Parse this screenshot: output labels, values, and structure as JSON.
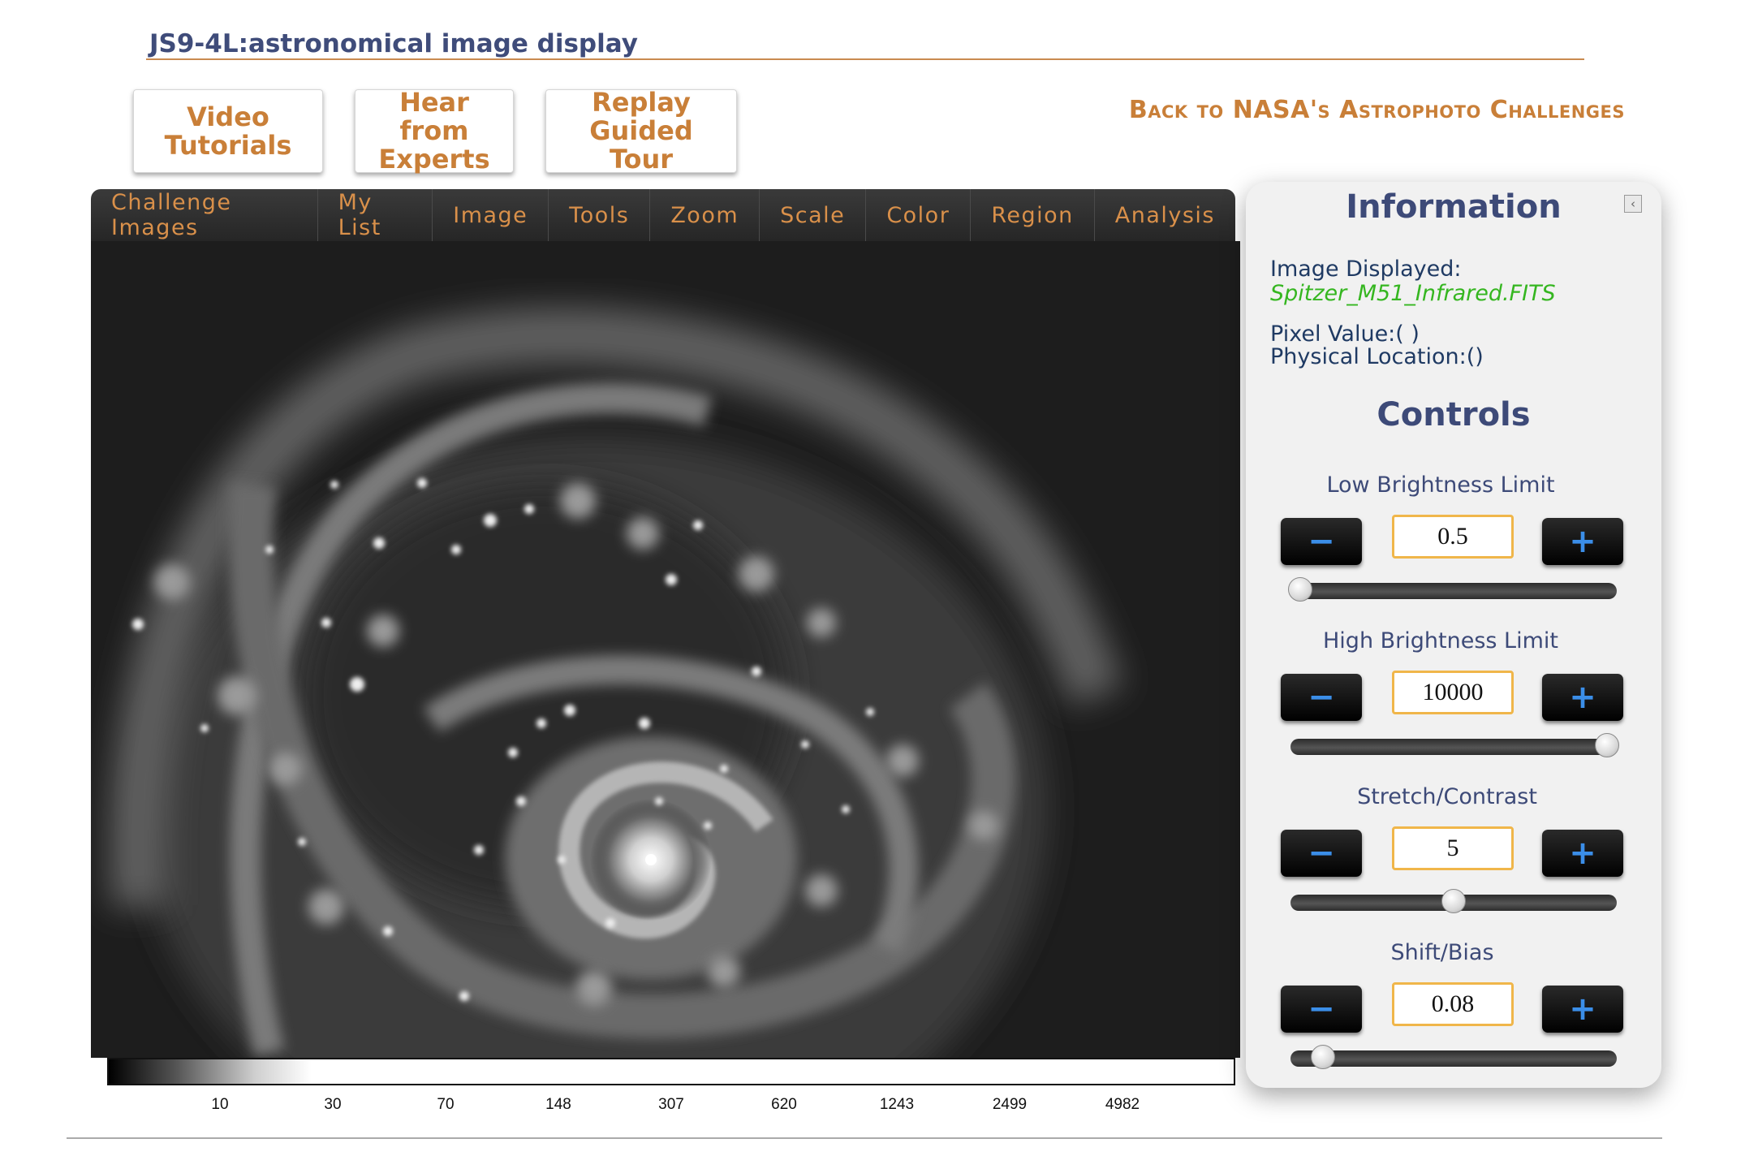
{
  "header": {
    "title": "JS9-4L:astronomical image display",
    "buttons": [
      {
        "label": "Video Tutorials"
      },
      {
        "label": "Hear from Experts"
      },
      {
        "label": "Replay Guided Tour"
      }
    ],
    "back_link": "Back to NASA's Astrophoto Challenges"
  },
  "menubar": {
    "items": [
      "Challenge Images",
      "My List",
      "Image",
      "Tools",
      "Zoom",
      "Scale",
      "Color",
      "Region",
      "Analysis"
    ]
  },
  "colorbar": {
    "ticks": [
      "10",
      "30",
      "70",
      "148",
      "307",
      "620",
      "1243",
      "2499",
      "4982"
    ]
  },
  "panel": {
    "information_heading": "Information",
    "image_displayed_label": "Image Displayed:",
    "image_filename": "Spitzer_M51_Infrared.FITS",
    "pixel_value_label": "Pixel Value:( )",
    "physical_location_label": "Physical Location:()",
    "controls_heading": "Controls",
    "controls": [
      {
        "label": "Low Brightness Limit",
        "value": "0.5",
        "slider_fraction": 0.03
      },
      {
        "label": "High Brightness Limit",
        "value": "10000",
        "slider_fraction": 0.97
      },
      {
        "label": "Stretch/Contrast",
        "value": "5",
        "slider_fraction": 0.5
      },
      {
        "label": "Shift/Bias",
        "value": "0.08",
        "slider_fraction": 0.1
      }
    ],
    "minus_label": "−",
    "plus_label": "+"
  }
}
